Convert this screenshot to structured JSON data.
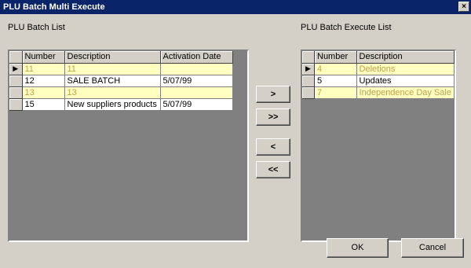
{
  "window": {
    "title": "PLU Batch Multi Execute",
    "close_glyph": "×"
  },
  "left_panel": {
    "label": "PLU Batch List",
    "headers": [
      "Number",
      "Description",
      "Activation Date"
    ],
    "current_row_glyph": "▶",
    "rows": [
      {
        "number": "11",
        "description": "11",
        "date": "",
        "style": "hl",
        "current": true
      },
      {
        "number": "12",
        "description": "SALE BATCH",
        "date": "5/07/99",
        "style": "nm",
        "current": false
      },
      {
        "number": "13",
        "description": "13",
        "date": "",
        "style": "hl",
        "current": false
      },
      {
        "number": "15",
        "description": "New suppliers products",
        "date": "5/07/99",
        "style": "nm",
        "current": false
      }
    ]
  },
  "right_panel": {
    "label": "PLU Batch Execute List",
    "headers": [
      "Number",
      "Description"
    ],
    "current_row_glyph": "▶",
    "rows": [
      {
        "number": "4",
        "description": "Deletions",
        "style": "hl",
        "current": true
      },
      {
        "number": "5",
        "description": "Updates",
        "style": "nm",
        "current": false
      },
      {
        "number": "7",
        "description": "Independence Day Sale",
        "style": "hl",
        "current": false
      }
    ]
  },
  "transfer_buttons": {
    "add_one": ">",
    "add_all": ">>",
    "remove_one": "<",
    "remove_all": "<<"
  },
  "dialog_buttons": {
    "ok": "OK",
    "cancel": "Cancel"
  },
  "colors": {
    "title_bar": "#0a246a",
    "face": "#d4d0c8",
    "highlight_row": "#ffffc0",
    "highlight_text": "#c0a050",
    "grid_bg": "#808080"
  }
}
